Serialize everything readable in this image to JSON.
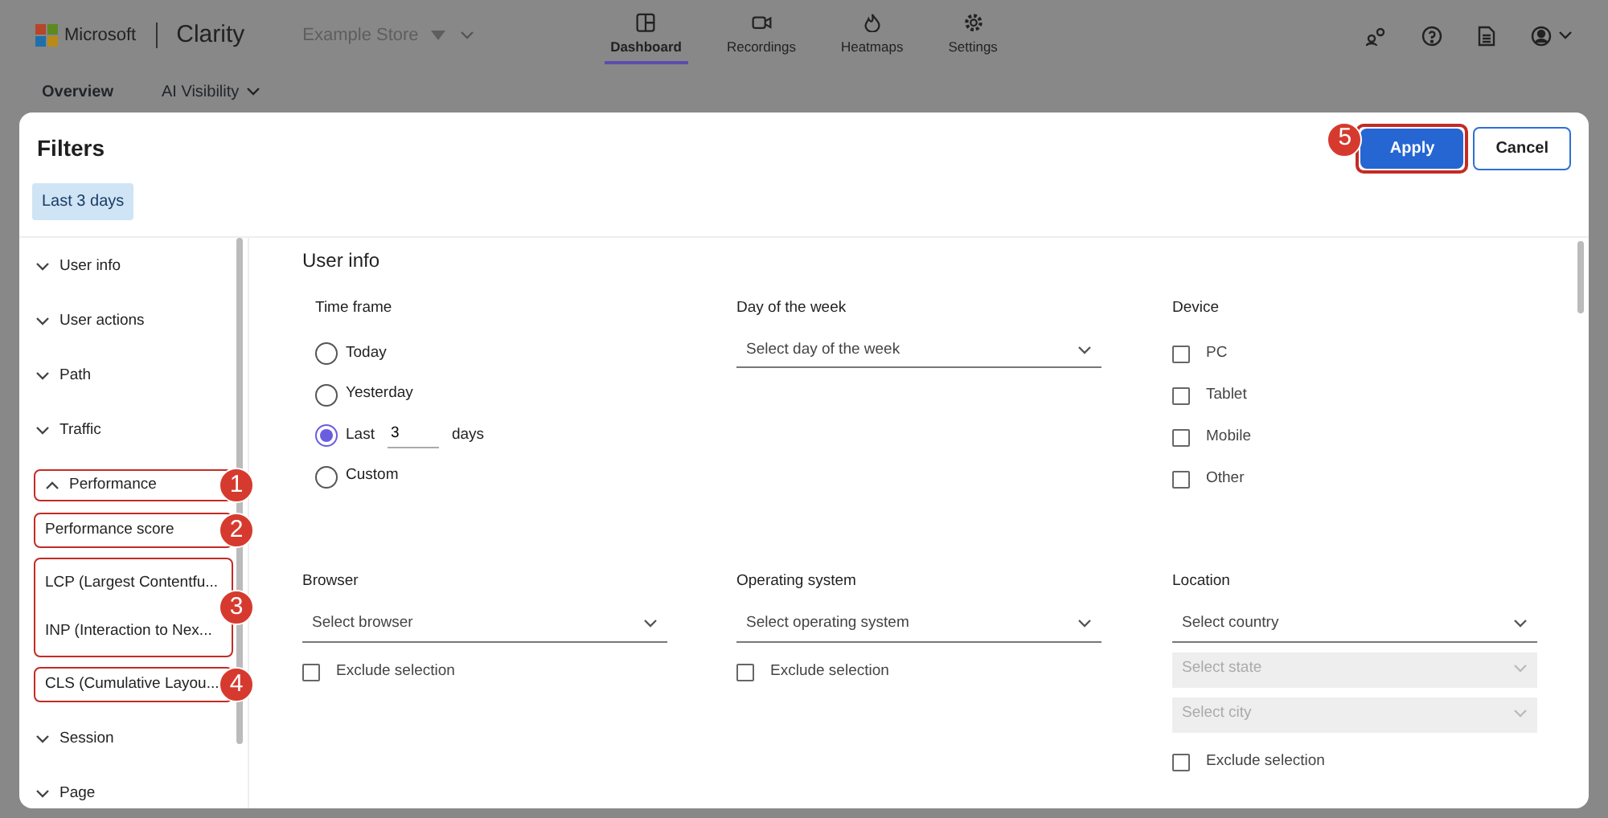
{
  "topbar": {
    "brand": "Microsoft",
    "product": "Clarity",
    "project": "Example Store",
    "nav": [
      {
        "label": "Dashboard",
        "selected": true
      },
      {
        "label": "Recordings",
        "selected": false
      },
      {
        "label": "Heatmaps",
        "selected": false
      },
      {
        "label": "Settings",
        "selected": false
      }
    ]
  },
  "subnav": [
    {
      "label": "Overview"
    },
    {
      "label": "AI Visibility"
    }
  ],
  "modal": {
    "title": "Filters",
    "buttons": [
      {
        "label": "Apply",
        "kind": "primary",
        "callout": "5"
      },
      {
        "label": "Cancel",
        "kind": "secondary"
      }
    ],
    "chips": [
      "Last 3 days"
    ],
    "sidebar": {
      "items": [
        {
          "label": "User info",
          "expanded": false
        },
        {
          "label": "User actions",
          "expanded": false
        },
        {
          "label": "Path",
          "expanded": false
        },
        {
          "label": "Traffic",
          "expanded": false
        },
        {
          "label": "Performance",
          "expanded": true,
          "callout": "1",
          "children": [
            {
              "callout": "2",
              "entries": [
                {
                  "label": "Performance score"
                }
              ]
            },
            {
              "callout": "3",
              "entries": [
                {
                  "label": "LCP (Largest Contentfu..."
                },
                {
                  "label": "INP (Interaction to Nex..."
                }
              ]
            },
            {
              "callout": "4",
              "entries": [
                {
                  "label": "CLS (Cumulative Layou..."
                }
              ]
            }
          ]
        },
        {
          "label": "Session",
          "expanded": false
        },
        {
          "label": "Page",
          "expanded": false
        }
      ]
    },
    "section_title": "User info",
    "time_frame": {
      "label": "Time frame",
      "options": [
        {
          "label": "Today",
          "kind": "plain",
          "selected": false
        },
        {
          "label": "Yesterday",
          "kind": "plain",
          "selected": false
        },
        {
          "label": "Last",
          "kind": "input",
          "value": "3",
          "suffix": "days",
          "selected": true
        },
        {
          "label": "Custom",
          "kind": "plain",
          "selected": false
        }
      ]
    },
    "day_of_week": {
      "label": "Day of the week",
      "placeholder": "Select day of the week"
    },
    "device": {
      "label": "Device",
      "options": [
        {
          "label": "PC",
          "checked": false
        },
        {
          "label": "Tablet",
          "checked": false
        },
        {
          "label": "Mobile",
          "checked": false
        },
        {
          "label": "Other",
          "checked": false
        }
      ]
    },
    "browser": {
      "label": "Browser",
      "placeholder": "Select browser",
      "exclude": {
        "label": "Exclude selection",
        "checked": false
      }
    },
    "operating_system": {
      "label": "Operating system",
      "placeholder": "Select operating system",
      "exclude": {
        "label": "Exclude selection",
        "checked": false
      }
    },
    "location": {
      "label": "Location",
      "selects": [
        {
          "placeholder": "Select country",
          "disabled": false
        },
        {
          "placeholder": "Select state",
          "disabled": true
        },
        {
          "placeholder": "Select city",
          "disabled": true
        }
      ],
      "exclude": {
        "label": "Exclude selection",
        "checked": false
      }
    }
  }
}
